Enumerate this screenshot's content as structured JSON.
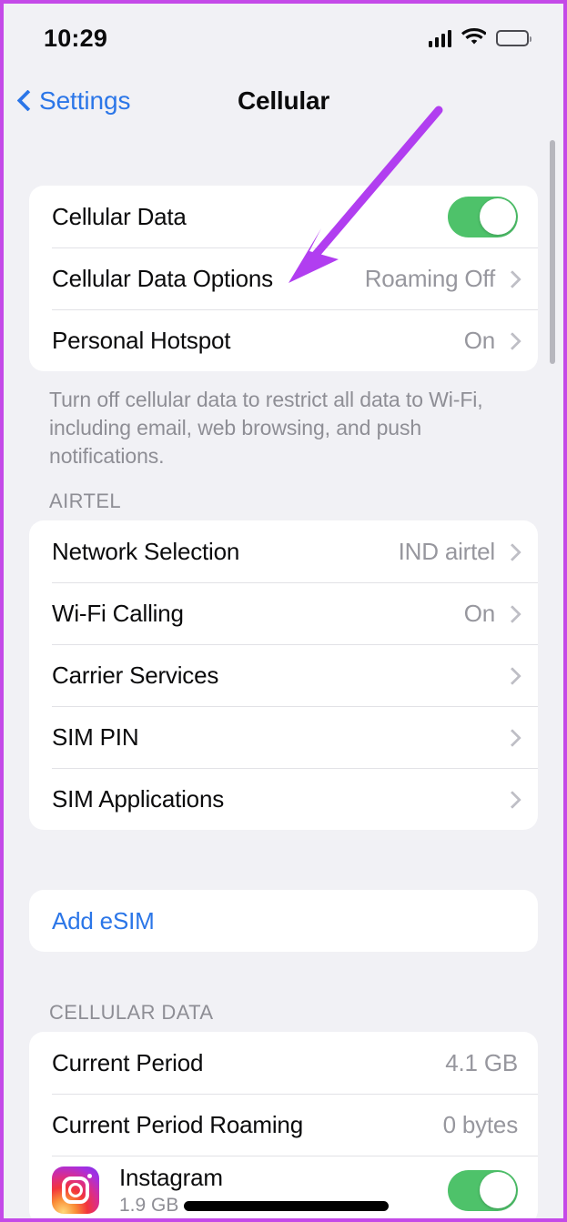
{
  "status_bar": {
    "time": "10:29",
    "signal_icon": "cellular-signal-icon",
    "wifi_icon": "wifi-icon",
    "battery_icon": "battery-icon"
  },
  "nav": {
    "back_label": "Settings",
    "title": "Cellular"
  },
  "groups": {
    "data_group": {
      "rows": [
        {
          "label": "Cellular Data",
          "value": "",
          "control": "toggle",
          "toggle_on": true
        },
        {
          "label": "Cellular Data Options",
          "value": "Roaming Off",
          "control": "chevron"
        },
        {
          "label": "Personal Hotspot",
          "value": "On",
          "control": "chevron"
        }
      ],
      "footer": "Turn off cellular data to restrict all data to Wi-Fi, including email, web browsing, and push notifications."
    },
    "carrier_group": {
      "header": "AIRTEL",
      "rows": [
        {
          "label": "Network Selection",
          "value": "IND airtel",
          "control": "chevron"
        },
        {
          "label": "Wi-Fi Calling",
          "value": "On",
          "control": "chevron"
        },
        {
          "label": "Carrier Services",
          "value": "",
          "control": "chevron"
        },
        {
          "label": "SIM PIN",
          "value": "",
          "control": "chevron"
        },
        {
          "label": "SIM Applications",
          "value": "",
          "control": "chevron"
        }
      ]
    },
    "esim_group": {
      "rows": [
        {
          "label": "Add eSIM"
        }
      ]
    },
    "cellular_data_group": {
      "header": "CELLULAR DATA",
      "rows": [
        {
          "label": "Current Period",
          "value": "4.1 GB"
        },
        {
          "label": "Current Period Roaming",
          "value": "0 bytes"
        }
      ],
      "apps": [
        {
          "name": "Instagram",
          "size": "1.9 GB",
          "icon": "instagram-app-icon",
          "toggle_on": true
        }
      ]
    }
  },
  "colors": {
    "accent_blue": "#2b76e8",
    "toggle_green": "#4ec26a",
    "secondary_text": "#8e8e95",
    "background": "#f1f1f5",
    "annotation_purple": "#b13ef0"
  },
  "annotation": {
    "arrow_color": "#b13ef0",
    "points_to": "Cellular Data Options"
  }
}
